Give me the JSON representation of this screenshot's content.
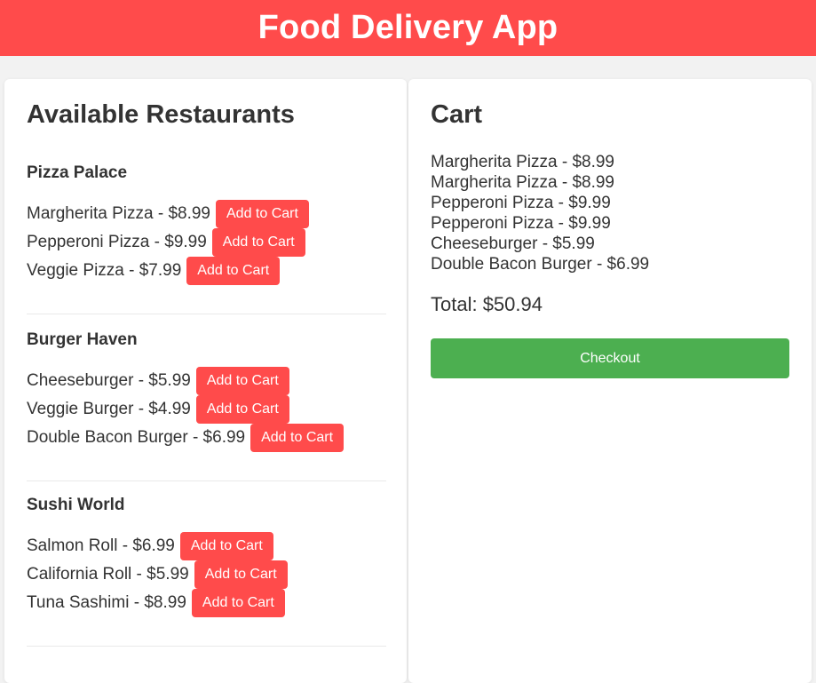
{
  "app": {
    "title": "Food Delivery App"
  },
  "restaurants_section": {
    "title": "Available Restaurants",
    "add_label": "Add to Cart",
    "restaurants": [
      {
        "name": "Pizza Palace",
        "items": [
          {
            "text": "Margherita Pizza - $8.99"
          },
          {
            "text": "Pepperoni Pizza - $9.99"
          },
          {
            "text": "Veggie Pizza - $7.99"
          }
        ]
      },
      {
        "name": "Burger Haven",
        "items": [
          {
            "text": "Cheeseburger - $5.99"
          },
          {
            "text": "Veggie Burger - $4.99"
          },
          {
            "text": "Double Bacon Burger - $6.99"
          }
        ]
      },
      {
        "name": "Sushi World",
        "items": [
          {
            "text": "Salmon Roll - $6.99"
          },
          {
            "text": "California Roll - $5.99"
          },
          {
            "text": "Tuna Sashimi - $8.99"
          }
        ]
      }
    ]
  },
  "cart": {
    "title": "Cart",
    "items": [
      "Margherita Pizza - $8.99",
      "Margherita Pizza - $8.99",
      "Pepperoni Pizza - $9.99",
      "Pepperoni Pizza - $9.99",
      "Cheeseburger - $5.99",
      "Double Bacon Burger - $6.99"
    ],
    "total": "Total: $50.94",
    "checkout_label": "Checkout"
  },
  "colors": {
    "header_bg": "#ff4b4b",
    "add_button": "#ff4b4b",
    "checkout_button": "#4caf50",
    "page_bg": "#f2f2f2"
  }
}
